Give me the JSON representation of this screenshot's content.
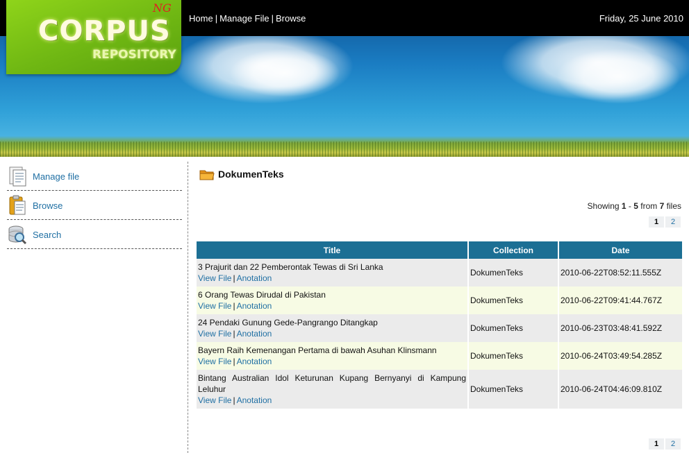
{
  "header": {
    "logo_main": "CORPUS",
    "logo_sub": "REPOSITORY",
    "logo_ng": "NG",
    "nav": [
      "Home",
      "Manage File",
      "Browse"
    ],
    "date": "Friday, 25 June 2010"
  },
  "sidebar": {
    "items": [
      {
        "label": "Manage file",
        "icon": "document-icon"
      },
      {
        "label": "Browse",
        "icon": "clipboard-icon"
      },
      {
        "label": "Search",
        "icon": "database-search-icon"
      }
    ]
  },
  "main": {
    "folder_title": "DokumenTeks",
    "showing_prefix": "Showing ",
    "showing_from": "1",
    "showing_dash": " - ",
    "showing_to": "5",
    "showing_mid": " from ",
    "showing_total": "7",
    "showing_suffix": " files",
    "pages": [
      "1",
      "2"
    ],
    "table": {
      "columns": [
        "Title",
        "Collection",
        "Date"
      ],
      "view_label": "View File",
      "anotation_label": "Anotation",
      "rows": [
        {
          "title": "3 Prajurit dan 22 Pemberontak Tewas di Sri Lanka",
          "collection": "DokumenTeks",
          "date": "2010-06-22T08:52:11.555Z"
        },
        {
          "title": "6 Orang Tewas Dirudal di Pakistan",
          "collection": "DokumenTeks",
          "date": "2010-06-22T09:41:44.767Z"
        },
        {
          "title": "24 Pendaki Gunung Gede-Pangrango Ditangkap",
          "collection": "DokumenTeks",
          "date": "2010-06-23T03:48:41.592Z"
        },
        {
          "title": "Bayern Raih Kemenangan Pertama di bawah Asuhan Klinsmann",
          "collection": "DokumenTeks",
          "date": "2010-06-24T03:49:54.285Z"
        },
        {
          "title": "Bintang Australian Idol Keturunan Kupang Bernyanyi di Kampung Leluhur",
          "collection": "DokumenTeks",
          "date": "2010-06-24T04:46:09.810Z"
        }
      ]
    }
  }
}
